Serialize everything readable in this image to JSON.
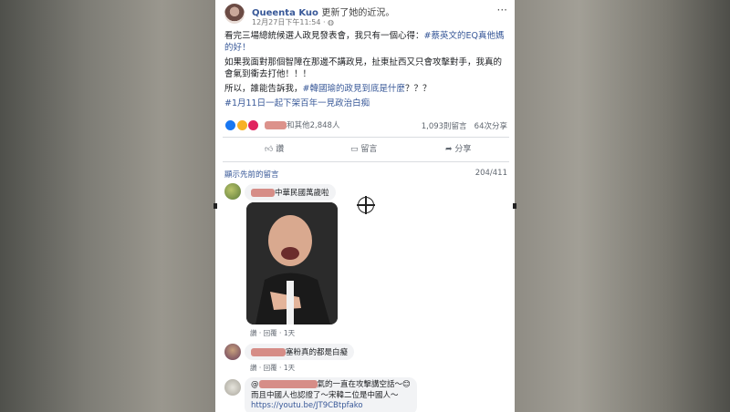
{
  "post": {
    "author": "Queenta Kuo",
    "status": "更新了她的近況。",
    "timestamp": "12月27日下午11:54 · ",
    "globe_icon": "globe-icon",
    "more": "···",
    "paragraphs": [
      {
        "text": "看完三場總統候選人政見發表會，我只有一個心得：",
        "tag": "#蔡英文的EQ真他媽的好！"
      },
      {
        "text": "如果我面對那個智障在那邊不講政見，扯東扯西又只會攻擊對手，我真的會氣到衝去打他！！！",
        "tag": ""
      },
      {
        "text": "所以，誰能告訴我，",
        "tag": "#韓國瑜的政見到底是什麼",
        "after": "？？？"
      },
      {
        "text": "",
        "tag": "#1月11日一起下架百年一見政治白痴"
      }
    ],
    "reactions_text": "和其他2,848人",
    "comment_count": "1,093則留言",
    "share_count": "64次分享"
  },
  "actions": {
    "like": "讚",
    "comment": "留言",
    "share": "分享"
  },
  "comments_header": {
    "show_previous": "顯示先前的留言",
    "page_count": "204/411"
  },
  "comments": [
    {
      "text": "中華民國萬歲啦",
      "like": "讚",
      "reply": "回覆",
      "time": "1天"
    },
    {
      "text": "塞粉真的都是白癡",
      "like": "讚",
      "reply": "回覆",
      "time": "1天"
    },
    {
      "line1_prefix": "@",
      "line1": "氣的一直在攻擊講空話～😊",
      "line2": "而且中國人也認證了～宋韓二位是中國人～",
      "line3": "https://youtu.be/JT9CBtpfako"
    }
  ]
}
